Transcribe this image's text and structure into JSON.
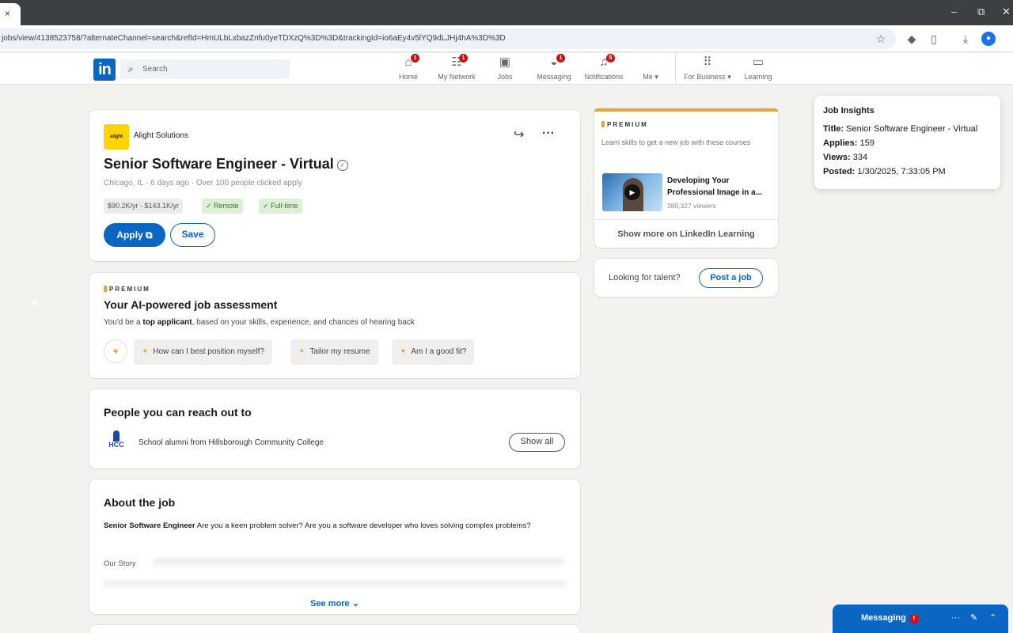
{
  "browser": {
    "tab_close": "×",
    "url": "jobs/view/4138523758/?alternateChannel=search&refId=HmULbLxbazZnfu0yeTDXzQ%3D%3D&trackingId=io6aEy4v5lYQ9dLJHj4hA%3D%3D",
    "window_controls": [
      "–",
      "⧉",
      "✕"
    ]
  },
  "nav": {
    "logo": "in",
    "search_placeholder": "Search",
    "items": [
      {
        "label": "Home",
        "badge": "1"
      },
      {
        "label": "My Network",
        "badge": "1"
      },
      {
        "label": "Jobs",
        "badge": ""
      },
      {
        "label": "Messaging",
        "badge": "1"
      },
      {
        "label": "Notifications",
        "badge": "5"
      },
      {
        "label": "Me ▾",
        "badge": ""
      },
      {
        "label": "For Business ▾",
        "badge": ""
      },
      {
        "label": "Learning",
        "badge": ""
      }
    ]
  },
  "job": {
    "company_logo_text": "alight",
    "company": "Alight Solutions",
    "title": "Senior Software Engineer - Virtual",
    "meta": "Chicago, IL · 6 days ago · Over 100 people clicked apply",
    "salary": "$90.2K/yr - $143.1K/yr",
    "tag_remote": "✓ Remote",
    "tag_fulltime": "✓ Full-time",
    "apply_label": "Apply ⧉",
    "save_label": "Save"
  },
  "assessment": {
    "premium": "PREMIUM",
    "title": "Your AI-powered job assessment",
    "sub_prefix": "You'd be a ",
    "sub_bold": "top applicant",
    "sub_suffix": ", based on your skills, experience, and chances of hearing back",
    "chips": [
      "How can I best position myself?",
      "Tailor my resume",
      "Am I a good fit?"
    ]
  },
  "people": {
    "title": "People you can reach out to",
    "logo": "HCC",
    "alumni": "School alumni from Hillsborough Community College",
    "show_all": "Show all"
  },
  "about": {
    "title": "About the job",
    "intro_bold": "Senior Software Engineer",
    "intro_rest": "  Are you a keen problem solver?  Are you a software developer who loves solving complex problems?",
    "story": "Our Story",
    "see_more": "See more ⌄"
  },
  "learning": {
    "premium": "PREMIUM",
    "sub": "Learn skills to get a new job with these courses",
    "course_title": "Developing Your Professional Image in a...",
    "course_views": "380,327 viewers",
    "show_more": "Show more on LinkedIn Learning"
  },
  "talent": {
    "text": "Looking for talent?",
    "button": "Post a job"
  },
  "insights": {
    "title": "Job Insights",
    "title_label": "Title:",
    "title_value": "Senior Software Engineer - Virtual",
    "applies_label": "Applies:",
    "applies_value": "159",
    "views_label": "Views:",
    "views_value": "334",
    "posted_label": "Posted:",
    "posted_value": "1/30/2025, 7:33:05 PM"
  },
  "messaging": {
    "label": "Messaging",
    "badge": "!"
  },
  "colors": {
    "linkedin_blue": "#0a66c2",
    "premium_gold": "#e7a33e",
    "badge_red": "#cc1016",
    "page_bg": "#f3f2ef"
  }
}
